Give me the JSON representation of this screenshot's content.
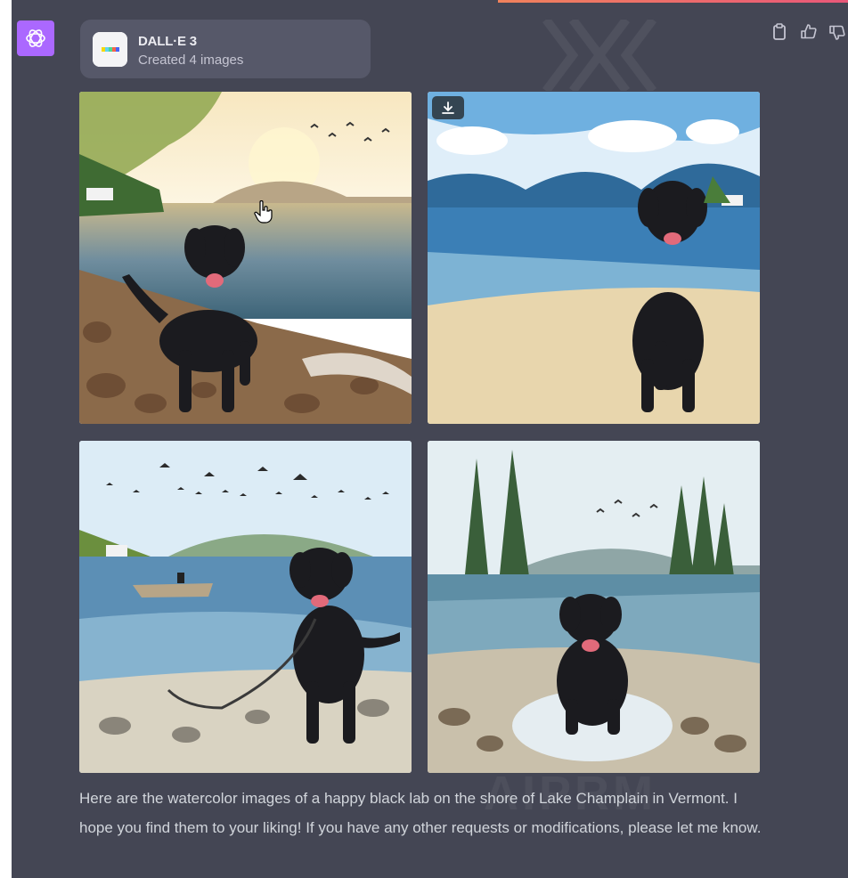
{
  "tool": {
    "name": "DALL·E 3",
    "status": "Created 4 images"
  },
  "images": [
    {
      "description": "Black lab on rocky lake shore at sunset, watercolor"
    },
    {
      "description": "Black lab standing on sandy beach with mountains, watercolor"
    },
    {
      "description": "Black lab on rocks with leash, boat and birds in sky, watercolor"
    },
    {
      "description": "Black lab splashing in water with pine trees, watercolor"
    }
  ],
  "message": {
    "text": "Here are the watercolor images of a happy black lab on the shore of Lake Champlain in Vermont. I hope you find them to your liking! If you have any other requests or modifications, please let me know."
  },
  "actions": [
    "clipboard-icon",
    "thumbs-up-icon",
    "thumbs-down-icon"
  ],
  "watermark": "AIPRM",
  "colors": {
    "panel_bg": "#444654",
    "card_bg": "#565869",
    "avatar_bg": "#ab68ff",
    "text": "#d1d5db"
  }
}
